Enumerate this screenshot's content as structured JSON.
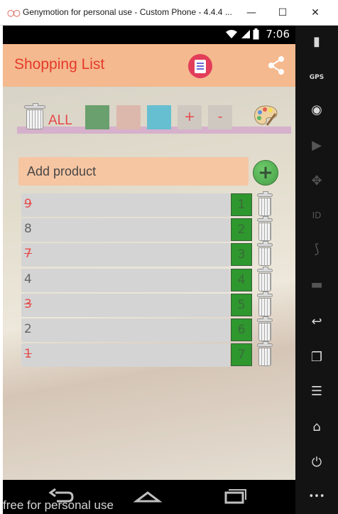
{
  "window": {
    "title": "Genymotion for personal use - Custom Phone - 4.4.4 ...",
    "minimize_label": "—",
    "maximize_label": "☐",
    "close_label": "✕"
  },
  "statusbar": {
    "time": "7:06"
  },
  "appbar": {
    "title": "Shopping List",
    "logo_icon": "shopping-list-logo-icon",
    "share_icon": "share-icon"
  },
  "toolbar": {
    "all_label": "ALL",
    "plus_label": "+",
    "minus_label": "-",
    "swatch_colors": [
      "#4a8a4f",
      "#d5a99a",
      "#45b1c6"
    ]
  },
  "add_product": {
    "label": "Add product",
    "button_label": "+"
  },
  "items": [
    {
      "name": "9",
      "qty": "1",
      "struck": true
    },
    {
      "name": "8",
      "qty": "2",
      "struck": false
    },
    {
      "name": "7",
      "qty": "3",
      "struck": true
    },
    {
      "name": "4",
      "qty": "4",
      "struck": false
    },
    {
      "name": "3",
      "qty": "5",
      "struck": true
    },
    {
      "name": "2",
      "qty": "6",
      "struck": false
    },
    {
      "name": "1",
      "qty": "7",
      "struck": true
    }
  ],
  "sidebar": {
    "gps_label": "GPS",
    "id_label": "ID",
    "more_label": "•••"
  },
  "watermark": "free for personal use",
  "colors": {
    "appbar": "#f4b98e",
    "accent_red": "#e53a2a",
    "qty_green": "#008000"
  }
}
